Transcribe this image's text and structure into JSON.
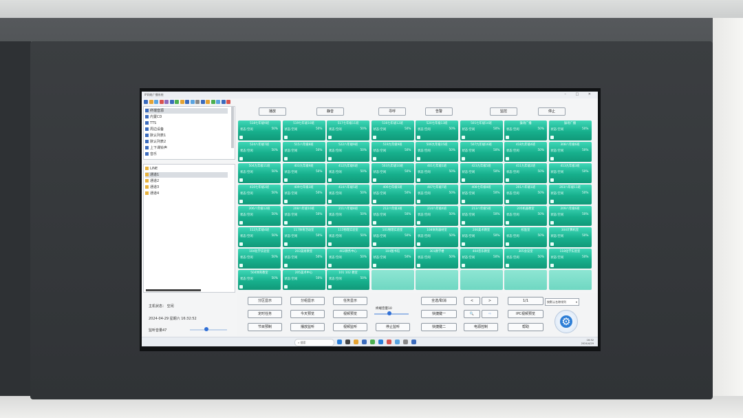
{
  "app": {
    "title": "IP网络广播系统",
    "window_controls": "– □ ✕"
  },
  "toolbar": {
    "icon_colors": [
      "#3b6bbd",
      "#e5a333",
      "#5aa4e0",
      "#d9534f",
      "#8e6bbd",
      "#3b6bbd",
      "#4caf50",
      "#e5a333",
      "#3b6bbd",
      "#5aa4e0",
      "#888888",
      "#3b6bbd",
      "#e5a333",
      "#4caf50",
      "#5aa4e0",
      "#3b6bbd",
      "#d9534f"
    ]
  },
  "tree": {
    "items": [
      {
        "label": "终端音源",
        "selected": true
      },
      {
        "label": "内置CD",
        "selected": false
      },
      {
        "label": "TTS",
        "selected": false
      },
      {
        "label": "周边设备",
        "selected": false
      },
      {
        "label": "默认列表1",
        "selected": false
      },
      {
        "label": "默认列表2",
        "selected": false
      },
      {
        "label": "上下课铃声",
        "selected": false
      },
      {
        "label": "音乐",
        "selected": false
      }
    ]
  },
  "channels": {
    "items": [
      {
        "label": "LINE",
        "selected": false
      },
      {
        "label": "通道1",
        "selected": true
      },
      {
        "label": "通道2",
        "selected": false
      },
      {
        "label": "通道3",
        "selected": false
      },
      {
        "label": "通道4",
        "selected": false
      }
    ]
  },
  "info": {
    "host_status": "主机状态：  空闲",
    "datetime": "2024-04-29  星期六  16:32:52",
    "volume": "监听音量47",
    "volume_level_pct": 45
  },
  "topbar": {
    "buttons": [
      "播放",
      "静音",
      "寻呼",
      "告警",
      "监控",
      "停止"
    ]
  },
  "grid": {
    "status_label": "状态:空闲",
    "volume_label": "50%",
    "cells": [
      "518七年级9班",
      "519七年级10班",
      "517七年级11班",
      "516七年级12班",
      "520七年级13班",
      "501七年级14班",
      "操场广播",
      "操场广播",
      "524八年级7班",
      "515八年级8班",
      "522八年级9班",
      "519九年级9班",
      "506九年级15班",
      "507九年级16班",
      "418九年级4班",
      "308八年级6班",
      "504九年级11班",
      "403九年级9班",
      "412九年级6班",
      "503九年级10班",
      "401七年级1班",
      "423九年级5班",
      "411九年级2班",
      "413九年级3班",
      "410七年级2班",
      "409七年级3班",
      "414八年级5班",
      "406七年级5班",
      "407七年级7班",
      "408七年级8班",
      "201八年级1班",
      "203八年级11班",
      "206八年级12班",
      "208八年级10班",
      "211八年级8班",
      "212八年级3班",
      "214八年级4班",
      "213八年级5班",
      "205机器教室",
      "209八年级6班",
      "112九年级4班",
      "117体育活动室",
      "115物理实验室",
      "101物理实验室",
      "108体育器材室",
      "206美术教室",
      "校医室",
      "304计算机室",
      "104化学实验室",
      "203美術教室",
      "402教务中心",
      "104图书馆",
      "301教学楼",
      "404音乐教室",
      "305会议室",
      "118化学实验室",
      "504体育教室",
      "205美术中心",
      "101 102 教室"
    ],
    "empty_count": 5
  },
  "controls": {
    "row1": [
      "分区显示",
      "分组显示",
      "任务显示"
    ],
    "row2": [
      "定时任务",
      "今天预览",
      "视频预览"
    ],
    "row3": [
      "节目预制",
      "播放监听",
      "视频监听"
    ],
    "listen_volume_label": "终端音量10",
    "stop_monitor": "停止监听",
    "select_all": "全选/取消",
    "hotkey1": "快捷键一",
    "hotkey2": "快捷键二",
    "page_prev": "<",
    "page_next": ">",
    "page_indicator": "1/1",
    "search_icon_label": "🔍",
    "ipc_preview": "IPC视频预览",
    "power_control": "电源控制",
    "help": "帮助",
    "sort_select": "按默认名称排列",
    "sort_arrow": "▾",
    "gear_glyph": "⚙",
    "listen_level_pct": 44
  },
  "taskbar": {
    "search_placeholder": "搜索",
    "time": "16:32",
    "date": "2024/4/29",
    "icon_colors": [
      "#2b7fd9",
      "#444444",
      "#e5a333",
      "#3b6bbd",
      "#4caf50",
      "#2b7fd9",
      "#d9534f",
      "#5aa4e0",
      "#888888",
      "#3b6bbd"
    ]
  }
}
